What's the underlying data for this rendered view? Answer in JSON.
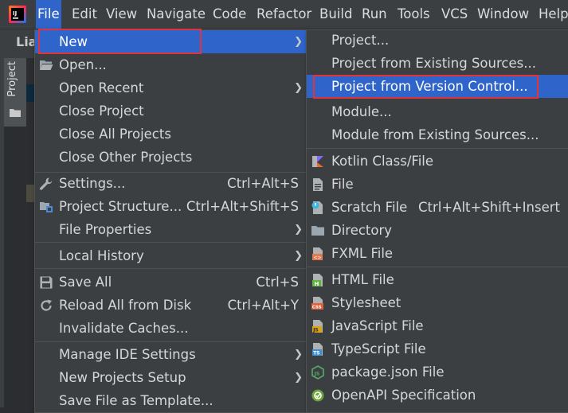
{
  "menubar": {
    "items": [
      {
        "label": "File",
        "mnemonic": "F"
      },
      {
        "label": "Edit"
      },
      {
        "label": "View"
      },
      {
        "label": "Navigate"
      },
      {
        "label": "Code"
      },
      {
        "label": "Refactor"
      },
      {
        "label": "Build"
      },
      {
        "label": "Run"
      },
      {
        "label": "Tools"
      },
      {
        "label": "VCS"
      },
      {
        "label": "Window"
      },
      {
        "label": "Help"
      }
    ],
    "active": "File"
  },
  "background": {
    "tab_label": "Lia",
    "project_tool_label": "Project"
  },
  "file_menu": {
    "items": [
      {
        "label": "New",
        "submenu": true,
        "selected": true
      },
      {
        "label": "Open...",
        "icon": "folder-open-icon"
      },
      {
        "label": "Open Recent",
        "submenu": true
      },
      {
        "label": "Close Project"
      },
      {
        "label": "Close All Projects"
      },
      {
        "label": "Close Other Projects"
      },
      {
        "label": "Settings...",
        "shortcut": "Ctrl+Alt+S",
        "icon": "wrench-icon"
      },
      {
        "label": "Project Structure...",
        "shortcut": "Ctrl+Alt+Shift+S",
        "icon": "project-structure-icon"
      },
      {
        "label": "File Properties",
        "submenu": true
      },
      {
        "label": "Local History",
        "submenu": true
      },
      {
        "label": "Save All",
        "shortcut": "Ctrl+S",
        "icon": "save-icon"
      },
      {
        "label": "Reload All from Disk",
        "shortcut": "Ctrl+Alt+Y",
        "icon": "reload-icon"
      },
      {
        "label": "Invalidate Caches..."
      },
      {
        "label": "Manage IDE Settings",
        "submenu": true
      },
      {
        "label": "New Projects Setup",
        "submenu": true
      },
      {
        "label": "Save File as Template..."
      }
    ]
  },
  "new_submenu": {
    "items": [
      {
        "label": "Project..."
      },
      {
        "label": "Project from Existing Sources..."
      },
      {
        "label": "Project from Version Control...",
        "selected": true
      },
      {
        "label": "Module..."
      },
      {
        "label": "Module from Existing Sources..."
      },
      {
        "label": "Kotlin Class/File",
        "icon": "kotlin-icon"
      },
      {
        "label": "File",
        "icon": "file-icon"
      },
      {
        "label": "Scratch File",
        "shortcut": "Ctrl+Alt+Shift+Insert",
        "icon": "scratch-file-icon"
      },
      {
        "label": "Directory",
        "icon": "directory-icon"
      },
      {
        "label": "FXML File",
        "icon": "fxml-icon"
      },
      {
        "label": "HTML File",
        "icon": "html-icon"
      },
      {
        "label": "Stylesheet",
        "icon": "css-icon"
      },
      {
        "label": "JavaScript File",
        "icon": "javascript-icon"
      },
      {
        "label": "TypeScript File",
        "icon": "typescript-icon"
      },
      {
        "label": "package.json File",
        "icon": "nodejs-icon"
      },
      {
        "label": "OpenAPI Specification",
        "icon": "openapi-icon"
      }
    ]
  },
  "icon_glyphs": {
    "submenu_arrow": "❯"
  },
  "colors": {
    "selection": "#2f65ca",
    "highlight_box": "#e0343c",
    "menu_bg": "#3c3f41"
  }
}
